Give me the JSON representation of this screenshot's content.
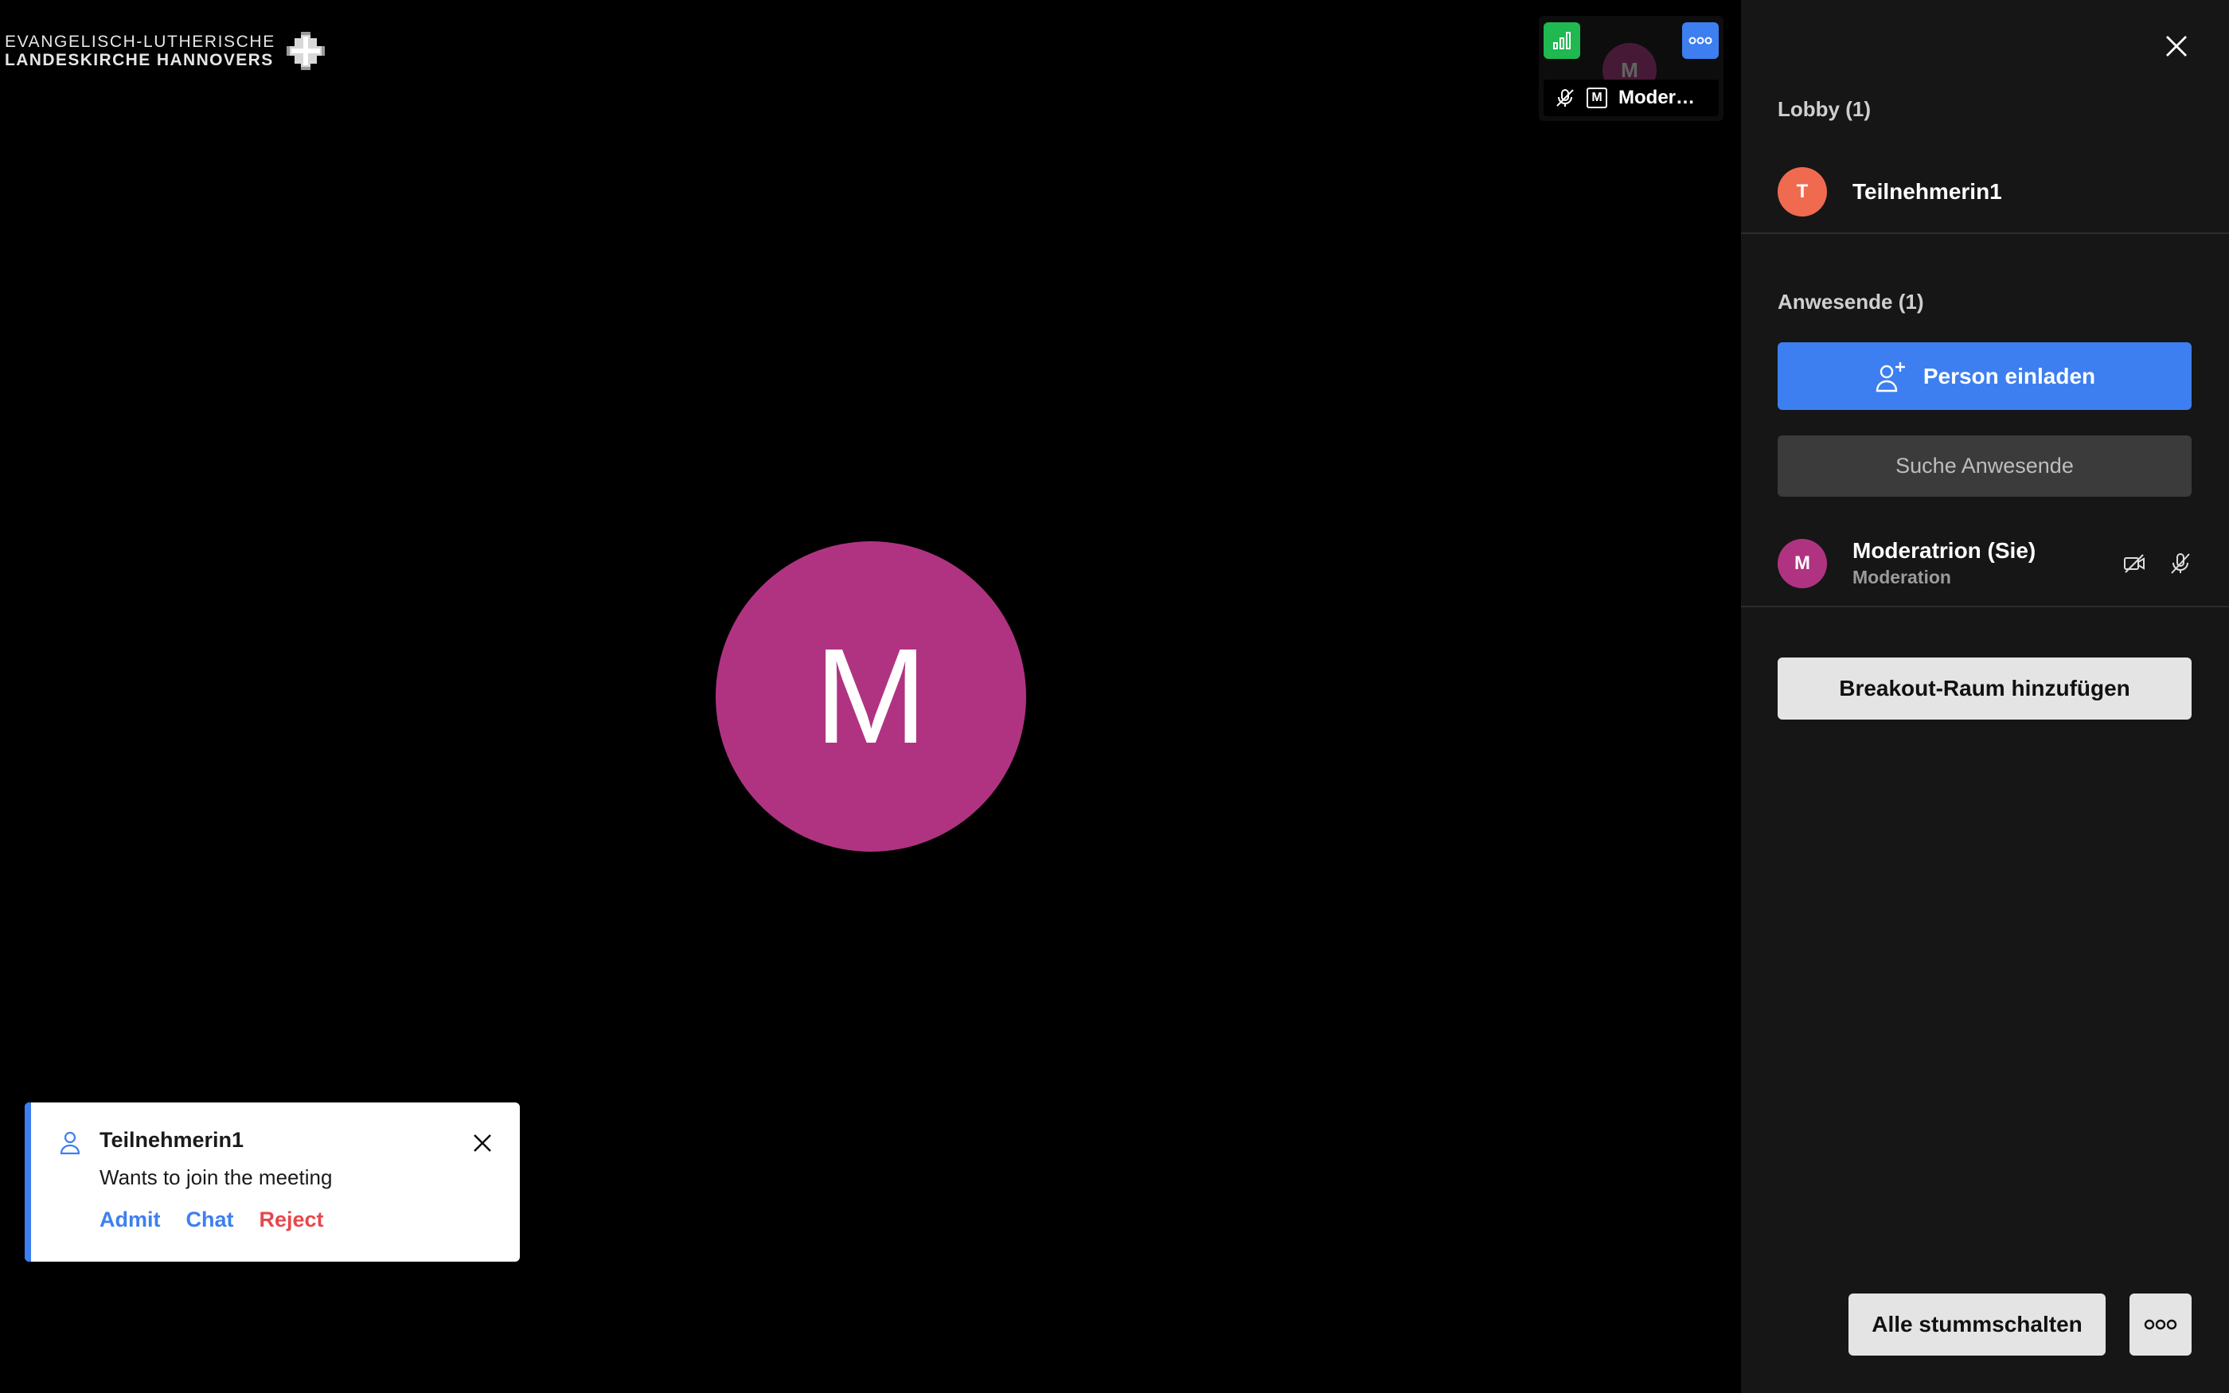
{
  "colors": {
    "accent_blue": "#3d7ff0",
    "reject_red": "#e5484d",
    "stats_green": "#1fb851",
    "avatar_magenta": "#b03382",
    "avatar_orange": "#f06a4f"
  },
  "logo": {
    "line1": "EVANGELISCH-LUTHERISCHE",
    "line2": "LANDESKIRCHE HANNOVERS",
    "icon": "cross-emblem-icon"
  },
  "stage": {
    "main_avatar_initial": "M",
    "thumbnail": {
      "avatar_initial": "M",
      "badge_letter": "M",
      "name": "Moder…",
      "icons": [
        "stats-icon",
        "more-options-icon",
        "mic-muted-icon"
      ]
    }
  },
  "notification": {
    "icon": "person-icon",
    "title": "Teilnehmerin1",
    "message": "Wants to join the meeting",
    "actions": {
      "admit": "Admit",
      "chat": "Chat",
      "reject": "Reject"
    }
  },
  "sidebar": {
    "lobby_title": "Lobby (1)",
    "lobby_participants": [
      {
        "initial": "T",
        "name": "Teilnehmerin1"
      }
    ],
    "present_title": "Anwesende (1)",
    "invite_label": "Person einladen",
    "search_placeholder": "Suche Anwesende",
    "participants": [
      {
        "initial": "M",
        "name": "Moderatrion (Sie)",
        "role": "Moderation",
        "icons": [
          "camera-off-icon",
          "mic-muted-icon"
        ]
      }
    ],
    "breakout_label": "Breakout-Raum hinzufügen",
    "mute_all_label": "Alle stummschalten"
  }
}
